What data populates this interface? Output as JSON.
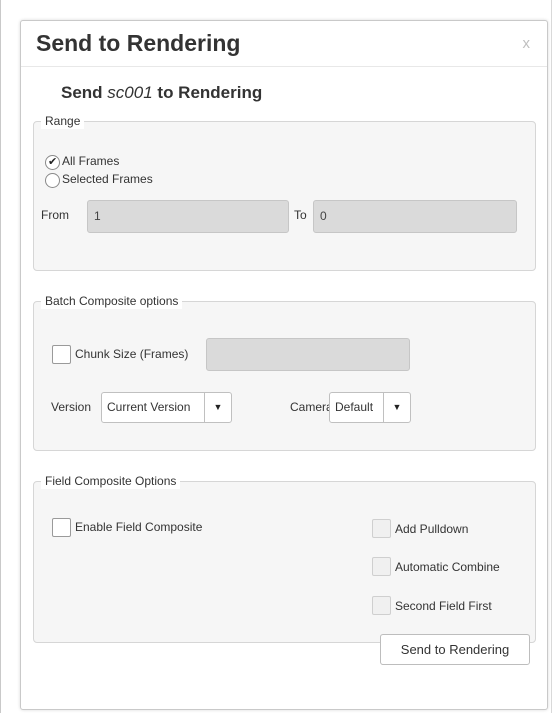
{
  "dialog": {
    "title": "Send to Rendering",
    "close_label": "x",
    "subtitle_prefix": "Send",
    "scene_name": "sc001",
    "subtitle_suffix": "to Rendering"
  },
  "range": {
    "legend": "Range",
    "options": [
      "All Frames",
      "Selected Frames"
    ],
    "selected": "All Frames",
    "from_label": "From",
    "from_value": "1",
    "to_label": "To",
    "to_value": "0"
  },
  "batch": {
    "legend": "Batch Composite options",
    "chunk_label": "Chunk Size (Frames)",
    "chunk_checked": false,
    "chunk_value": "",
    "version_label": "Version",
    "version_value": "Current Version",
    "camera_label": "Camera",
    "camera_value": "Default"
  },
  "field": {
    "legend": "Field Composite Options",
    "enable_label": "Enable Field Composite",
    "add_pulldown_label": "Add Pulldown",
    "automatic_combine_label": "Automatic Combine",
    "second_field_first_label": "Second Field First"
  },
  "footer": {
    "send_button": "Send to Rendering"
  },
  "icons": {
    "checkmark": "checkmark-icon",
    "dropdown": "caret-down-icon"
  }
}
